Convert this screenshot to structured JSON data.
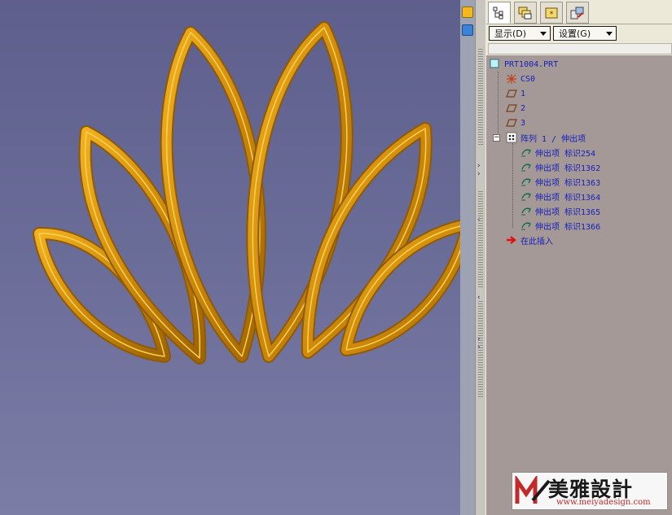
{
  "panel": {
    "tabs": [
      {
        "name": "model-tree",
        "icon": "model-tree-icon"
      },
      {
        "name": "folder-browser",
        "icon": "folder-browser-icon"
      },
      {
        "name": "favorites",
        "icon": "favorites-folder-icon"
      },
      {
        "name": "connections",
        "icon": "connections-icon"
      }
    ],
    "toolbar": {
      "show_label": "显示(D)",
      "settings_label": "设置(G)"
    }
  },
  "tree": {
    "root": "PRT1004.PRT",
    "items": [
      {
        "label": "CS0",
        "icon": "coordinate-system-icon"
      },
      {
        "label": "1",
        "icon": "datum-plane-icon"
      },
      {
        "label": "2",
        "icon": "datum-plane-icon"
      },
      {
        "label": "3",
        "icon": "datum-plane-icon"
      }
    ],
    "pattern": {
      "label": "阵列 1 / 伸出项",
      "icon": "pattern-icon",
      "expander": "−"
    },
    "children": [
      {
        "label": "伸出项 标识254",
        "icon": "protrusion-icon"
      },
      {
        "label": "伸出项 标识1362",
        "icon": "protrusion-icon"
      },
      {
        "label": "伸出项 标识1363",
        "icon": "protrusion-icon"
      },
      {
        "label": "伸出项 标识1364",
        "icon": "protrusion-icon"
      },
      {
        "label": "伸出项 标识1365",
        "icon": "protrusion-icon"
      },
      {
        "label": "伸出项 标识1366",
        "icon": "protrusion-icon"
      }
    ],
    "insert_here": {
      "label": "在此插入",
      "icon": "insert-arrow-icon"
    }
  },
  "watermark": {
    "title": "美雅設計",
    "url": "www.meiyadesign.com"
  },
  "colors": {
    "viewport_top": "#5e5f8c",
    "viewport_bottom": "#7b7da6",
    "model_gold": "#d68f0e",
    "tree_background": "#a59998",
    "tree_text": "#1722b8",
    "insert_arrow": "#e01010"
  }
}
